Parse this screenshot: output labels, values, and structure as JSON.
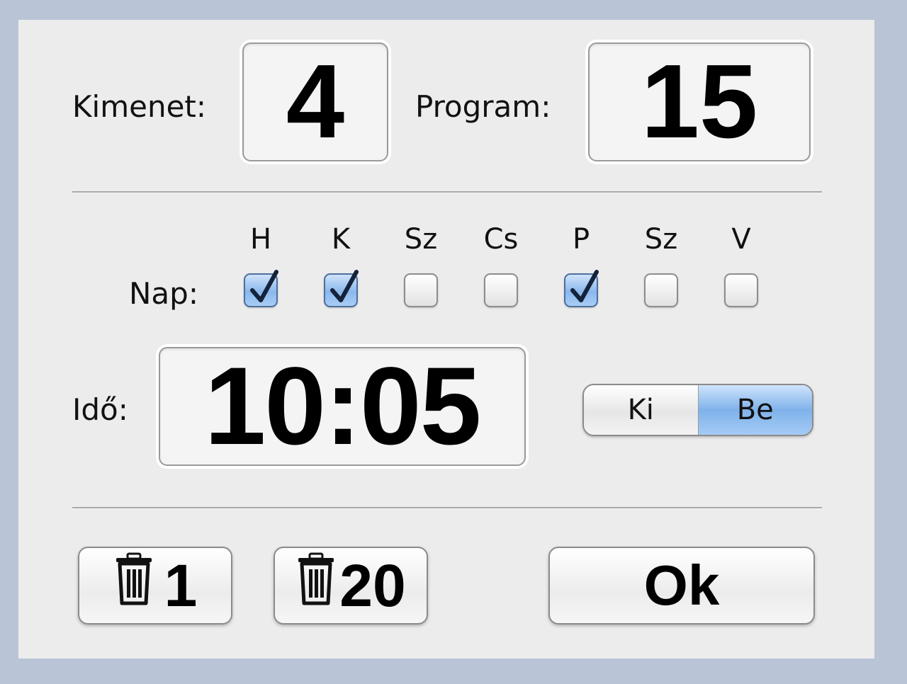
{
  "output": {
    "label": "Kimenet:",
    "value": "4"
  },
  "program": {
    "label": "Program:",
    "value": "15"
  },
  "days": {
    "label": "Nap:",
    "items": [
      {
        "letter": "H",
        "checked": true
      },
      {
        "letter": "K",
        "checked": true
      },
      {
        "letter": "Sz",
        "checked": false
      },
      {
        "letter": "Cs",
        "checked": false
      },
      {
        "letter": "P",
        "checked": true
      },
      {
        "letter": "Sz",
        "checked": false
      },
      {
        "letter": "V",
        "checked": false
      }
    ]
  },
  "time": {
    "label": "Idő:",
    "value": "10:05"
  },
  "switch": {
    "off_label": "Ki",
    "on_label": "Be",
    "selected": "Be",
    "active_color": "#7fb2ea"
  },
  "buttons": {
    "delete_one": {
      "icon": "trash-icon",
      "label": "1"
    },
    "delete_all": {
      "icon": "trash-icon",
      "label": "20"
    },
    "ok": {
      "label": "Ok"
    }
  },
  "colors": {
    "window_background": "#ececec",
    "desktop_background": "#b9c4d6",
    "checkbox_checked": "#8ab8ec"
  }
}
